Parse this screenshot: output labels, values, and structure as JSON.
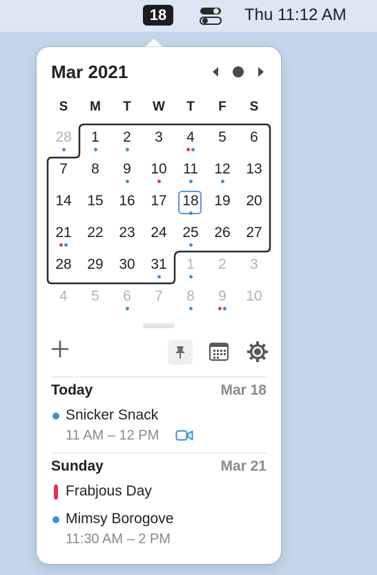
{
  "menubar": {
    "date_badge": "18",
    "clock": "Thu 11:12 AM"
  },
  "calendar": {
    "month_title": "Mar 2021",
    "weekdays": [
      "S",
      "M",
      "T",
      "W",
      "T",
      "F",
      "S"
    ],
    "weeks": [
      [
        {
          "d": "28",
          "other": true,
          "dots": [
            "blue"
          ]
        },
        {
          "d": "1",
          "dots": [
            "blue"
          ]
        },
        {
          "d": "2",
          "dots": [
            "blue"
          ]
        },
        {
          "d": "3",
          "dots": []
        },
        {
          "d": "4",
          "dots": [
            "red",
            "blue"
          ]
        },
        {
          "d": "5",
          "dots": []
        },
        {
          "d": "6",
          "dots": []
        }
      ],
      [
        {
          "d": "7",
          "dots": []
        },
        {
          "d": "8",
          "dots": []
        },
        {
          "d": "9",
          "dots": [
            "blue"
          ]
        },
        {
          "d": "10",
          "dots": [
            "red"
          ]
        },
        {
          "d": "11",
          "dots": [
            "blue"
          ]
        },
        {
          "d": "12",
          "dots": [
            "blue"
          ]
        },
        {
          "d": "13",
          "dots": []
        }
      ],
      [
        {
          "d": "14",
          "dots": []
        },
        {
          "d": "15",
          "dots": []
        },
        {
          "d": "16",
          "dots": []
        },
        {
          "d": "17",
          "dots": []
        },
        {
          "d": "18",
          "dots": [
            "blue"
          ],
          "today": true
        },
        {
          "d": "19",
          "dots": []
        },
        {
          "d": "20",
          "dots": []
        }
      ],
      [
        {
          "d": "21",
          "dots": [
            "red",
            "blue"
          ]
        },
        {
          "d": "22",
          "dots": []
        },
        {
          "d": "23",
          "dots": []
        },
        {
          "d": "24",
          "dots": []
        },
        {
          "d": "25",
          "dots": [
            "blue"
          ]
        },
        {
          "d": "26",
          "dots": []
        },
        {
          "d": "27",
          "dots": []
        }
      ],
      [
        {
          "d": "28",
          "dots": []
        },
        {
          "d": "29",
          "dots": []
        },
        {
          "d": "30",
          "dots": []
        },
        {
          "d": "31",
          "dots": [
            "blue"
          ]
        },
        {
          "d": "1",
          "other": true,
          "dots": [
            "blue"
          ]
        },
        {
          "d": "2",
          "other": true,
          "dots": []
        },
        {
          "d": "3",
          "other": true,
          "dots": []
        }
      ],
      [
        {
          "d": "4",
          "other": true,
          "dots": []
        },
        {
          "d": "5",
          "other": true,
          "dots": []
        },
        {
          "d": "6",
          "other": true,
          "dots": [
            "blue"
          ]
        },
        {
          "d": "7",
          "other": true,
          "dots": []
        },
        {
          "d": "8",
          "other": true,
          "dots": [
            "blue"
          ]
        },
        {
          "d": "9",
          "other": true,
          "dots": [
            "red",
            "blue"
          ]
        },
        {
          "d": "10",
          "other": true,
          "dots": []
        }
      ]
    ]
  },
  "toolbar": {
    "add_icon": "plus-icon",
    "pin_icon": "pin-icon",
    "calendar_icon": "calendar-grid-icon",
    "settings_icon": "gear-icon"
  },
  "agenda": {
    "sections": [
      {
        "title": "Today",
        "date": "Mar 18",
        "events": [
          {
            "title": "Snicker Snack",
            "time": "11 AM – 12 PM",
            "marker": "dot"
          }
        ]
      },
      {
        "title": "Sunday",
        "date": "Mar 21",
        "events": [
          {
            "title": "Frabjous Day",
            "marker": "bar"
          },
          {
            "title": "Mimsy Borogove",
            "time": "11:30 AM – 2 PM",
            "marker": "dot"
          }
        ]
      }
    ]
  },
  "colors": {
    "accent_blue": "#3f8fd2",
    "accent_red": "#e0364f",
    "today_outline": "#5c97df"
  }
}
